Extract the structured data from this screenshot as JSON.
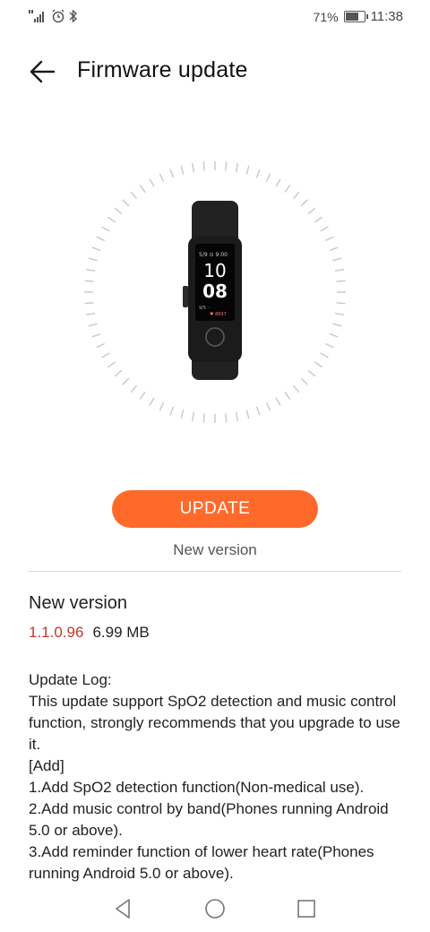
{
  "status_bar": {
    "battery_percent": "71%",
    "battery_level": 0.71,
    "time": "11:38",
    "icons": [
      "signal-icon",
      "alarm-icon",
      "bluetooth-icon",
      "battery-icon"
    ]
  },
  "header": {
    "title": "Firmware update",
    "back_icon": "arrow-left-icon"
  },
  "device": {
    "screen_date": "5/9 ⊙ 9:00",
    "screen_hour": "10",
    "screen_minute": "08",
    "screen_sub": "9/5  ◦",
    "screen_steps": "♥ 8697"
  },
  "update": {
    "button_label": "UPDATE",
    "status": "New version"
  },
  "details": {
    "section_title": "New version",
    "version": "1.1.0.96",
    "size": "6.99 MB",
    "log": [
      "Update Log:",
      "This update support SpO2 detection and music control function, strongly recommends that you upgrade to use it.",
      "[Add]",
      "1.Add SpO2 detection function(Non-medical use).",
      "2.Add music control by band(Phones running Android 5.0 or above).",
      "3.Add reminder function of lower heart rate(Phones running Android 5.0 or above)."
    ]
  },
  "colors": {
    "accent": "#ff6a2a",
    "version_red": "#c0392b"
  },
  "nav": {
    "back": "nav-back-icon",
    "home": "nav-home-icon",
    "recents": "nav-recents-icon"
  }
}
